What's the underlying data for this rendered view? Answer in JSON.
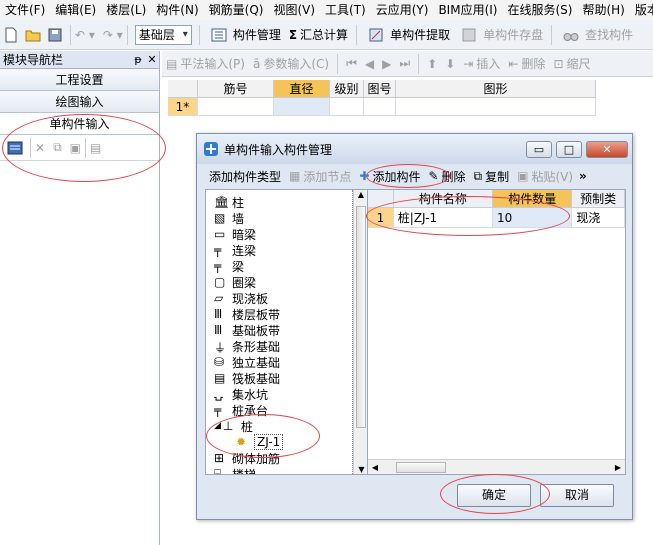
{
  "menubar": [
    "文件(F)",
    "编辑(E)",
    "楼层(L)",
    "构件(N)",
    "钢筋量(Q)",
    "视图(V)",
    "工具(T)",
    "云应用(Y)",
    "BIM应用(I)",
    "在线服务(S)",
    "帮助(H)",
    "版本号"
  ],
  "toolbar": {
    "floor_combo": "基础层",
    "component_manage": "构件管理",
    "sum_calc": "汇总计算",
    "single_extract": "单构件提取",
    "single_save": "单构件存盘",
    "find_component": "查找构件"
  },
  "nav": {
    "title": "模块导航栏",
    "pin": "ᵽ",
    "close": "✕",
    "items": [
      "工程设置",
      "绘图输入",
      "单构件输入"
    ]
  },
  "right_toolbar": {
    "flat_input": "平法输入(P)",
    "param_input": "参数输入(C)",
    "insert": "插入",
    "delete": "删除",
    "shrink": "缩尺"
  },
  "grid": {
    "columns": [
      "",
      "筋号",
      "直径(mm)",
      "级别",
      "图号",
      "图形"
    ],
    "row_marker": "1*"
  },
  "dialog": {
    "title": "单构件输入构件管理",
    "toolbar": {
      "add_type": "添加构件类型",
      "add_node": "添加节点",
      "add_component": "添加构件",
      "delete": "删除",
      "copy": "复制",
      "paste": "粘贴(V)",
      "more": "»"
    },
    "tree": [
      "柱",
      "墙",
      "暗梁",
      "连梁",
      "梁",
      "圈梁",
      "现浇板",
      "楼层板带",
      "基础板带",
      "条形基础",
      "独立基础",
      "筏板基础",
      "集水坑",
      "桩承台",
      "桩",
      "ZJ-1",
      "砌体加筋",
      "楼梯"
    ],
    "table": {
      "columns": [
        "",
        "构件名称",
        "构件数量",
        "预制类"
      ],
      "rows": [
        {
          "index": "1",
          "name": "桩|ZJ-1",
          "count": "10",
          "type": "现浇"
        }
      ]
    },
    "ok": "确定",
    "cancel": "取消",
    "minimize": "▭",
    "maximize": "□",
    "close": "✕"
  },
  "colors": {
    "accent_header": "#f5b942",
    "selection": "#fcd58a",
    "annotation": "#e4424d"
  }
}
